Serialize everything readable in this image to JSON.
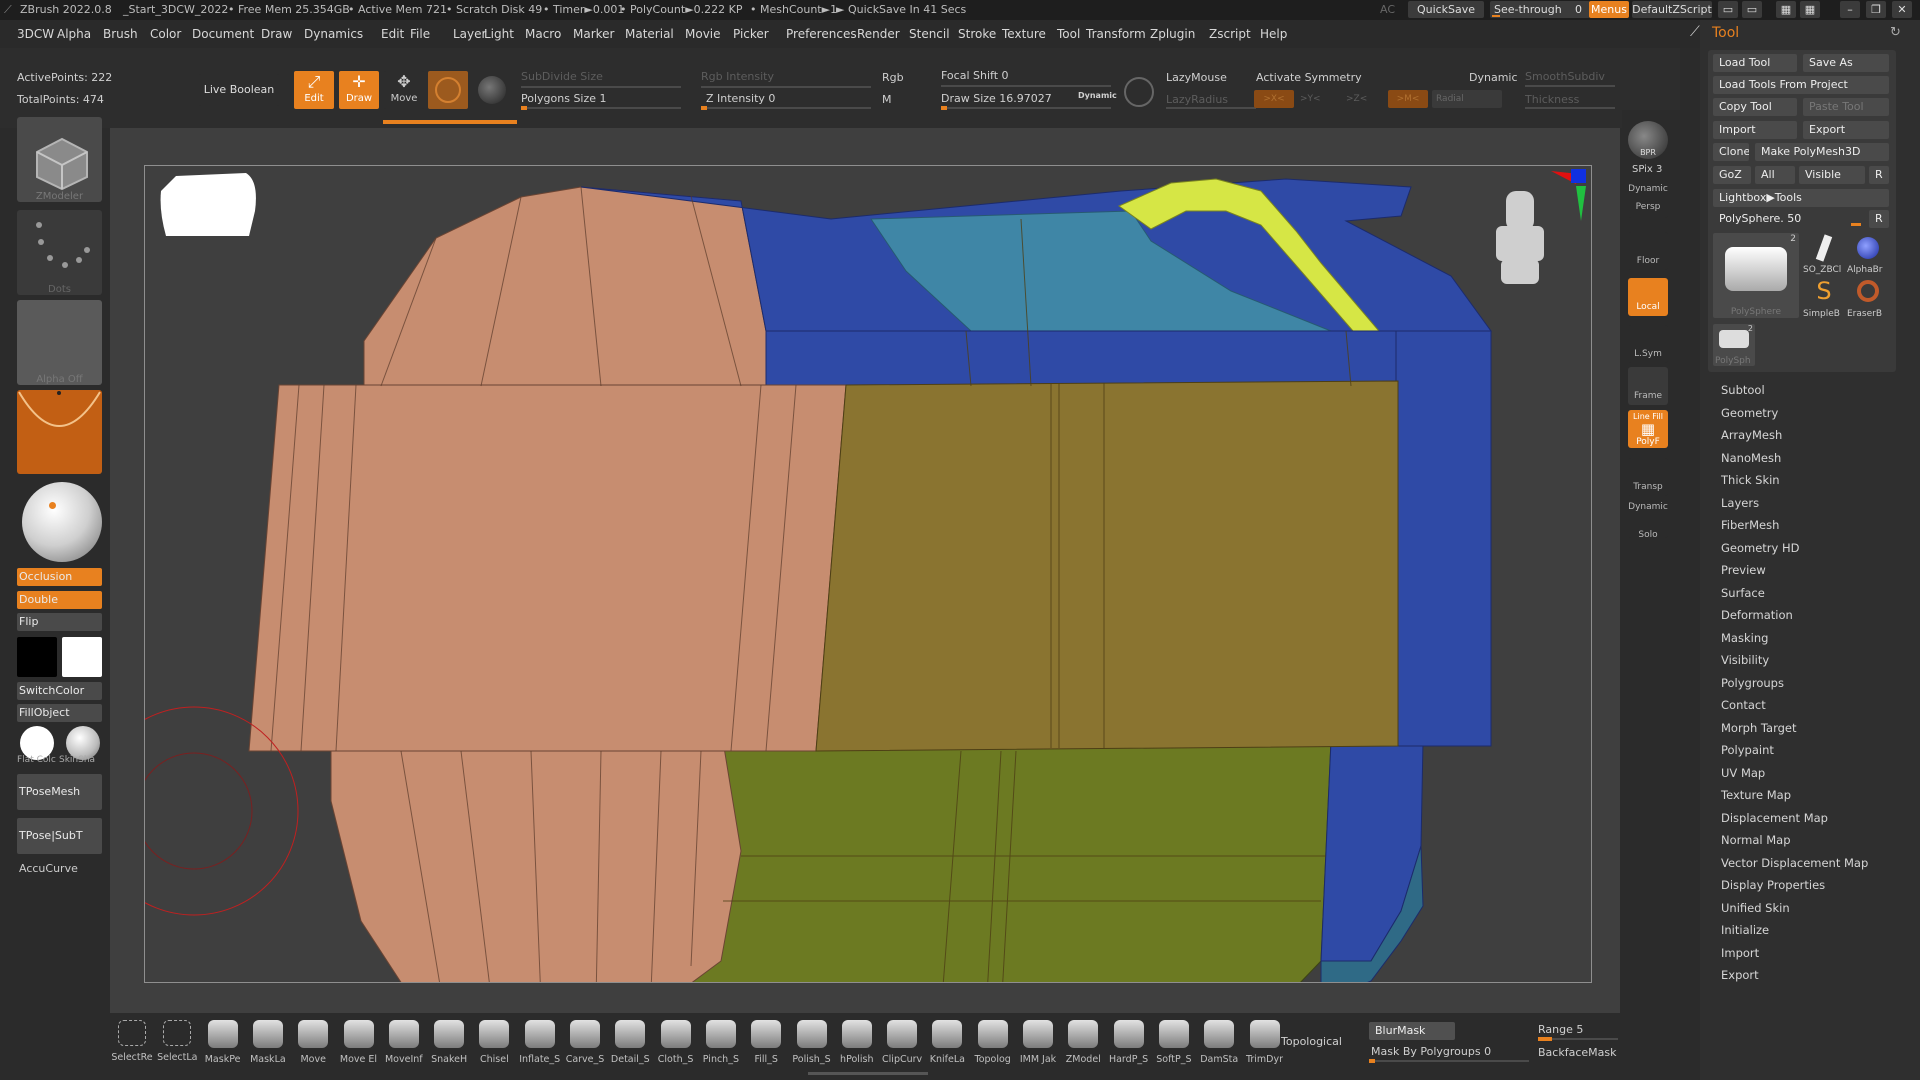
{
  "title_bar": {
    "app": "ZBrush 2022.0.8",
    "document": "_Start_3DCW_2022",
    "free_mem": "• Free Mem 25.354GB",
    "active_mem": "• Active Mem 721",
    "scratch_disk": "• Scratch Disk 49",
    "timer": "• Timer►0.001",
    "polycount": "• PolyCount►0.222 KP",
    "meshcount": "• MeshCount►1",
    "quicksave_info": "► QuickSave In 41 Secs",
    "ac": "AC",
    "quicksave_button": "QuickSave",
    "see_through_label": "See-through",
    "see_through_value": "0",
    "see_through_level": 0,
    "menus_button": "Menus",
    "script_button": "DefaultZScript"
  },
  "menu_bar": {
    "items": [
      "3DCW",
      "Alpha",
      "Brush",
      "Color",
      "Document",
      "Draw",
      "Dynamics",
      "Edit",
      "File",
      "Layer",
      "Light",
      "Macro",
      "Marker",
      "Material",
      "Movie",
      "Picker",
      "Preferences",
      "Render",
      "Stencil",
      "Stroke",
      "Texture",
      "Tool",
      "Transform",
      "Zplugin",
      "Zscript",
      "Help"
    ]
  },
  "stats": {
    "active_points": "ActivePoints: 222",
    "total_points": "TotalPoints: 474"
  },
  "top_shelf": {
    "live_boolean": "Live Boolean",
    "edit": "Edit",
    "draw": "Draw",
    "move": "Move",
    "subdivide_size": "SubDivide Size",
    "polygons_size": "Polygons Size 1",
    "rgb_intensity": "Rgb Intensity",
    "z_intensity": "Z Intensity 0",
    "rgb": "Rgb",
    "m": "M",
    "focal_shift": "Focal Shift 0",
    "draw_size": "Draw Size 16.97027",
    "dynamic_small": "Dynamic",
    "lazymouse": "LazyMouse",
    "lazyradius": "LazyRadius",
    "activate_symmetry": "Activate Symmetry",
    "dynamic": "Dynamic",
    "smooth_subdiv": "SmoothSubdiv",
    "thickness": "Thickness",
    "sym_x": ">X<",
    "sym_y": ">Y<",
    "sym_z": ">Z<",
    "sym_m": ">M<",
    "radial": "Radial"
  },
  "left_tray": {
    "zmodeler": "ZModeler",
    "dots": "Dots",
    "alpha_off": "Alpha Off",
    "occlusion": "Occlusion",
    "double": "Double",
    "flip": "Flip",
    "switchcolor": "SwitchColor",
    "fillobject": "FillObject",
    "flat_color": "Flat Colc",
    "skinshade": "SkinSha",
    "tposemesh": "TPoseMesh",
    "tpose_subt": "TPose|SubT",
    "accucurve": "AccuCurve"
  },
  "right_tray": {
    "bpr": "BPR",
    "spix": "SPix 3",
    "dynamic": "Dynamic",
    "persp": "Persp",
    "floor": "Floor",
    "local": "Local",
    "lsym": "L.Sym",
    "frame": "Frame",
    "line_fill": "Line Fill",
    "polyf": "PolyF",
    "transp": "Transp",
    "solo": "Solo"
  },
  "tool_panel": {
    "header": "Tool",
    "load_tool": "Load Tool",
    "save_as": "Save As",
    "load_from_project": "Load Tools From Project",
    "copy_tool": "Copy Tool",
    "paste_tool": "Paste Tool",
    "import": "Import",
    "export": "Export",
    "clone": "Clone",
    "make_polymesh": "Make PolyMesh3D",
    "goz": "GoZ",
    "all": "All",
    "visible": "Visible",
    "r": "R",
    "lightbox_tools": "Lightbox▶Tools",
    "polysphere_slider": "PolySphere. 50",
    "thumb_polysphere": "PolySphere",
    "thumb_count": "2",
    "thumb_so": "SO_ZBCl",
    "thumb_alphabr": "AlphaBr",
    "thumb_simpleb": "SimpleB",
    "thumb_eraserb": "EraserB",
    "thumb_polysph": "PolySph",
    "subpalettes": [
      "Subtool",
      "Geometry",
      "ArrayMesh",
      "NanoMesh",
      "Thick Skin",
      "Layers",
      "FiberMesh",
      "Geometry HD",
      "Preview",
      "Surface",
      "Deformation",
      "Masking",
      "Visibility",
      "Polygroups",
      "Contact",
      "Morph Target",
      "Polypaint",
      "UV Map",
      "Texture Map",
      "Displacement Map",
      "Normal Map",
      "Vector Displacement Map",
      "Display Properties",
      "Unified Skin",
      "Initialize",
      "Import",
      "Export"
    ]
  },
  "bottom_bar": {
    "brushes": [
      "SelectRe",
      "SelectLa",
      "MaskPe",
      "MaskLa",
      "Move",
      "Move El",
      "MoveInf",
      "SnakeH",
      "Chisel",
      "Inflate_S",
      "Carve_S",
      "Detail_S",
      "Cloth_S",
      "Pinch_S",
      "Fill_S",
      "Polish_S",
      "hPolish",
      "ClipCurv",
      "KnifeLa",
      "Topolog",
      "IMM Jak",
      "ZModel",
      "HardP_S",
      "SoftP_S",
      "DamSta",
      "TrimDyr"
    ],
    "topological": "Topological",
    "blurmask": "BlurMask",
    "mask_by_polygroups": "Mask By Polygroups 0",
    "range": "Range 5",
    "backfacemask": "BackfaceMask"
  },
  "colors": {
    "accent": "#e8811f",
    "mesh_salmon": "#c78d70",
    "mesh_olive": "#8a7430",
    "mesh_green": "#6c7a22",
    "mesh_blue": "#2f4aa6",
    "mesh_teal": "#3f86a6",
    "mesh_yellow": "#d6e645"
  }
}
